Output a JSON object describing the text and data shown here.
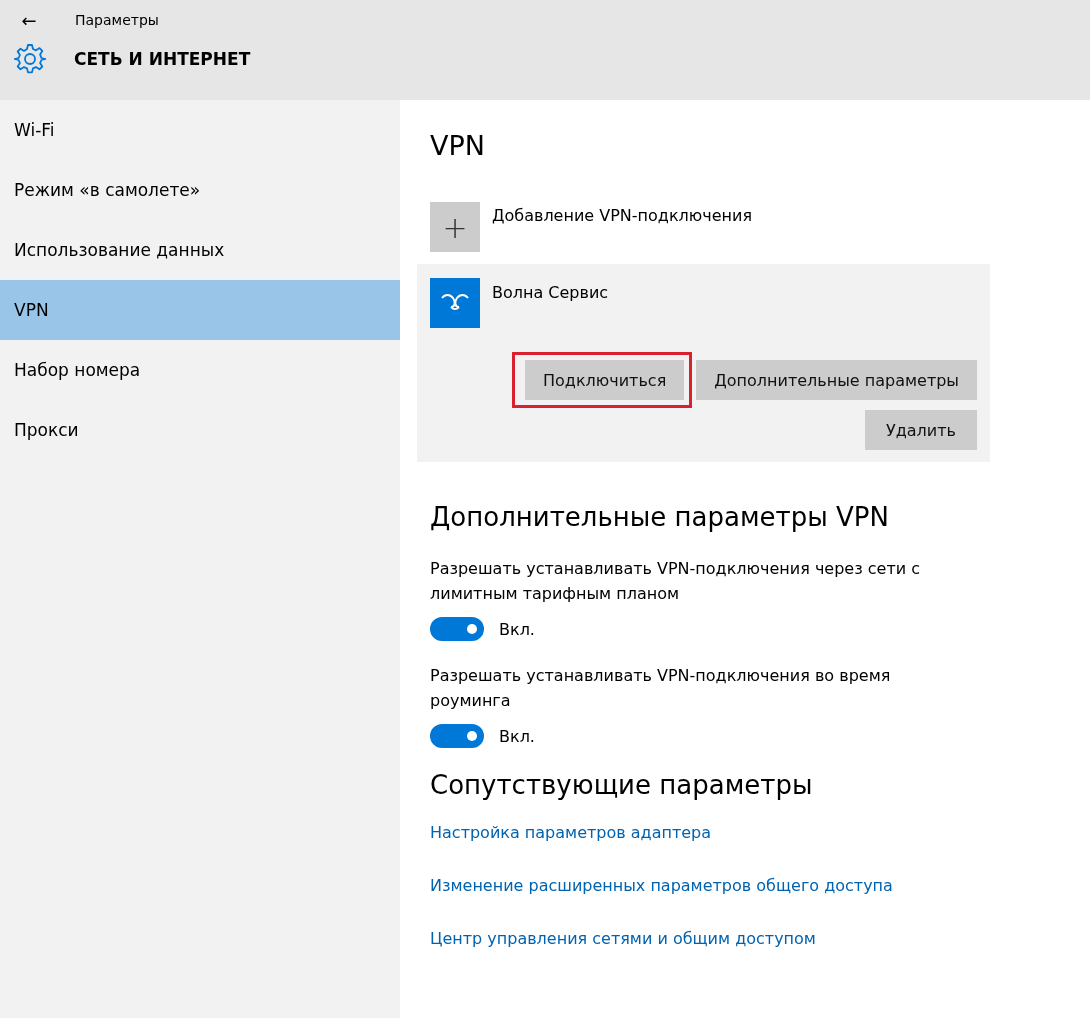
{
  "window": {
    "title": "Параметры",
    "back": "←"
  },
  "header": {
    "title": "СЕТЬ И ИНТЕРНЕТ"
  },
  "sidebar": {
    "items": [
      {
        "label": "Wi-Fi",
        "selected": false
      },
      {
        "label": "Режим «в самолете»",
        "selected": false
      },
      {
        "label": "Использование данных",
        "selected": false
      },
      {
        "label": "VPN",
        "selected": true
      },
      {
        "label": "Набор номера",
        "selected": false
      },
      {
        "label": "Прокси",
        "selected": false
      }
    ]
  },
  "vpn": {
    "title": "VPN",
    "add": {
      "icon": "+",
      "label": "Добавление VPN-подключения"
    },
    "connections": [
      {
        "name": "Волна Сервис",
        "buttons": [
          {
            "label": "Подключиться",
            "highlighted": true
          },
          {
            "label": "Дополнительные параметры",
            "highlighted": false
          },
          {
            "label": "Удалить",
            "highlighted": false
          }
        ]
      }
    ]
  },
  "advanced": {
    "title": "Дополнительные параметры VPN",
    "settings": [
      {
        "label": "Разрешать устанавливать VPN-подключения через сети с лимитным тарифным планом",
        "on": true,
        "state": "Вкл."
      },
      {
        "label": "Разрешать устанавливать VPN-подключения во время роуминга",
        "on": true,
        "state": "Вкл."
      }
    ]
  },
  "related": {
    "title": "Сопутствующие параметры",
    "links": [
      "Настройка параметров адаптера",
      "Изменение расширенных параметров общего доступа",
      "Центр управления сетями и общим доступом"
    ]
  }
}
